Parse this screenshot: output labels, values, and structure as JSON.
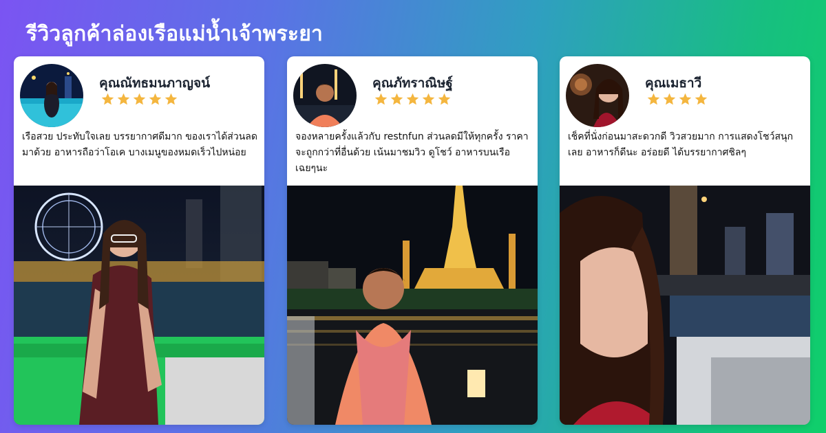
{
  "page": {
    "title": "รีวิวลูกค้าล่องเรือแม่น้ำเจ้าพระยา"
  },
  "colors": {
    "star": "#f4b63f",
    "name": "#1b2330",
    "card": "#ffffff"
  },
  "reviews": [
    {
      "name": "คุณณัทธมนภาญจน์",
      "rating": 5,
      "text": "เรือสวย ประทับใจเลย บรรยากาศดีมาก ของเราได้ส่วนลดมาด้วย อาหารถือว่าโอเค บางเมนูของหมดเร็วไปหน่อย",
      "photo": "woman-in-purple-dress-with-ferris-wheel-night"
    },
    {
      "name": "คุณภัทราณิษฐ์",
      "rating": 5,
      "text": "จองหลายครั้งแล้วกับ restnfun ส่วนลดมีให้ทุกครั้ง ราคาจะถูกกว่าที่อื่นด้วย เน้นมาชมวิว ดูโชว์ อาหารบนเรือเฉยๆนะ",
      "photo": "woman-in-pink-with-wat-arun-night"
    },
    {
      "name": "คุณเมธาวี",
      "rating": 4,
      "text": "เช็คที่นั่งก่อนมาสะดวกดี วิวสวยมาก การแสดงโชว์สนุกเลย อาหารก็ดีนะ อร่อยดี ได้บรรยากาศชิลๆ",
      "photo": "woman-selfie-with-city-skyline-night"
    }
  ]
}
